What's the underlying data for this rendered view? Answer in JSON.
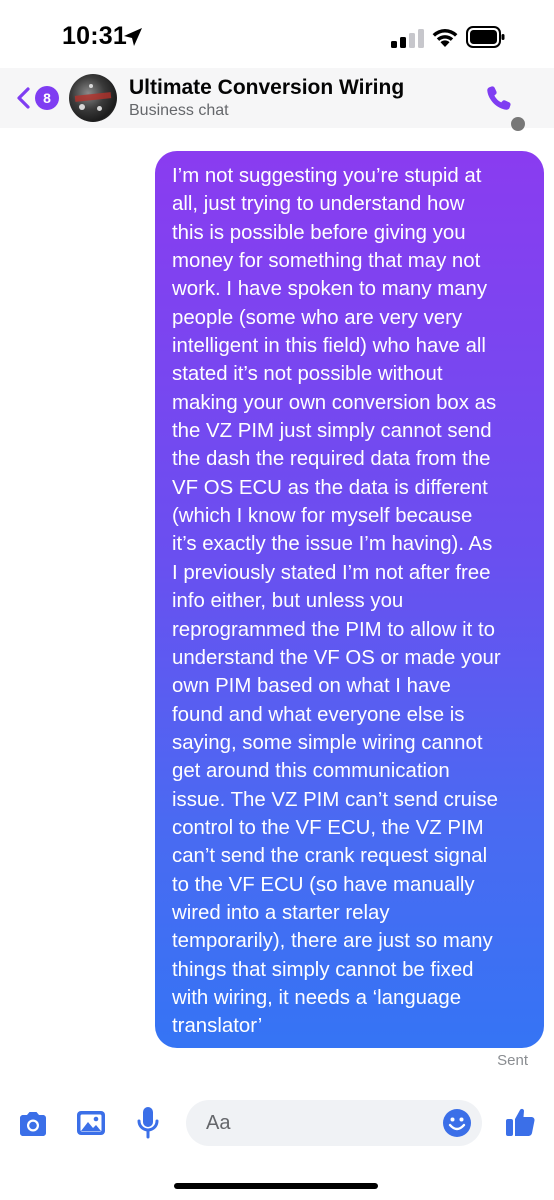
{
  "status_bar": {
    "time": "10:31",
    "icons": [
      "location-arrow-icon",
      "cellular-signal-icon",
      "wifi-icon",
      "battery-icon"
    ]
  },
  "header": {
    "back_count": "8",
    "title": "Ultimate Conversion Wiring",
    "subtitle": "Business chat",
    "icons": [
      "back-chevron-icon",
      "phone-call-icon"
    ]
  },
  "conversation": {
    "messages": [
      {
        "direction": "outgoing",
        "lines": [
          "I’m not suggesting you’re stupid at",
          "all, just trying to understand how",
          "this is possible before giving you",
          "money for something that may not",
          "work. I have spoken to many many",
          "people (some who are very very",
          "intelligent in this field) who have all",
          "stated it’s not possible without",
          "making your own conversion box as",
          "the VZ PIM just simply cannot send",
          "the dash the required data from the",
          "VF OS ECU as the data is different",
          "(which I know for myself because",
          "it’s exactly the issue I’m having). As",
          "I previously stated I’m not after free",
          "info either, but unless you",
          "reprogrammed the PIM to allow it to",
          "understand the VF OS or made your",
          "own PIM based on what I have",
          "found and what everyone else is",
          "saying, some simple wiring cannot",
          "get around this communication",
          "issue. The VZ PIM can’t send cruise",
          "control to the VF ECU, the VZ PIM",
          "can’t send the crank request signal",
          "to the VF ECU (so have manually",
          "wired into a starter relay",
          "temporarily), there are just so many",
          "things that simply cannot be fixed",
          "with wiring, it needs a ‘language",
          "translator’"
        ],
        "status": "Sent"
      }
    ]
  },
  "composer": {
    "placeholder": "Aa",
    "icons": [
      "camera-icon",
      "gallery-icon",
      "microphone-icon",
      "emoji-icon",
      "thumbs-up-icon"
    ]
  },
  "colors": {
    "accent": "#7f3df2",
    "composer_icon": "#3b6fe8",
    "bubble_top": "#8a3cf0",
    "bubble_bottom": "#3574f4",
    "header_bg": "#f6f6f7",
    "muted_text": "#65676b"
  }
}
